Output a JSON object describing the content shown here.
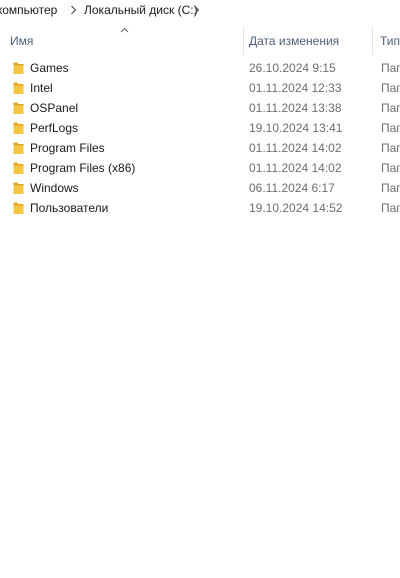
{
  "breadcrumb": {
    "items": [
      {
        "label": "т компьютер"
      },
      {
        "label": "Локальный диск (C:)"
      }
    ]
  },
  "columns": {
    "name": "Имя",
    "date": "Дата изменения",
    "type": "Тип"
  },
  "files": [
    {
      "name": "Games",
      "date": "26.10.2024 9:15",
      "type": "Пап"
    },
    {
      "name": "Intel",
      "date": "01.11.2024 12:33",
      "type": "Пап"
    },
    {
      "name": "OSPanel",
      "date": "01.11.2024 13:38",
      "type": "Пап"
    },
    {
      "name": "PerfLogs",
      "date": "19.10.2024 13:41",
      "type": "Пап"
    },
    {
      "name": "Program Files",
      "date": "01.11.2024 14:02",
      "type": "Пап"
    },
    {
      "name": "Program Files (x86)",
      "date": "01.11.2024 14:02",
      "type": "Пап"
    },
    {
      "name": "Windows",
      "date": "06.11.2024 6:17",
      "type": "Пап"
    },
    {
      "name": "Пользователи",
      "date": "19.10.2024 14:52",
      "type": "Пап"
    }
  ],
  "icons": {
    "folder": "folder-icon",
    "separator": "chevron-right-icon",
    "sort": "sort-up-icon"
  },
  "colors": {
    "folder_body": "#f6c544",
    "folder_shade": "#e0a81f",
    "header_text": "#4c607a"
  }
}
